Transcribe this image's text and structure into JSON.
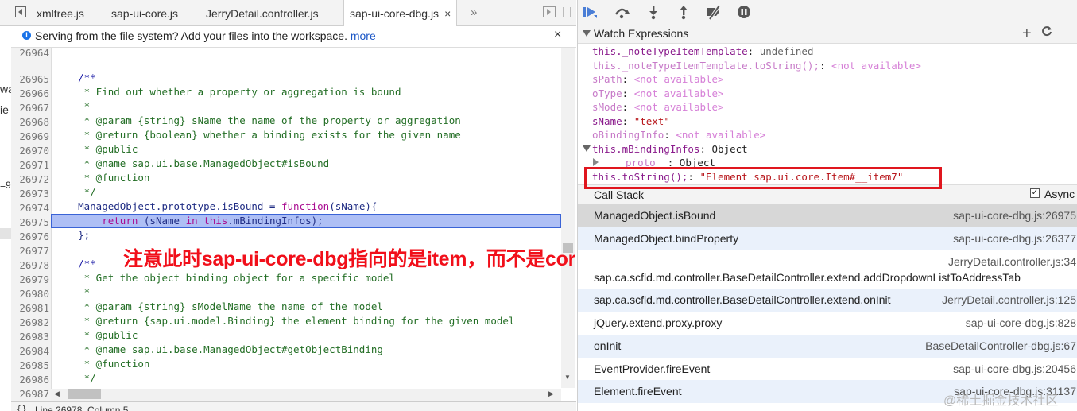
{
  "editor": {
    "tabs": [
      {
        "label": "xmltree.js"
      },
      {
        "label": "sap-ui-core.js"
      },
      {
        "label": "JerryDetail.controller.js"
      },
      {
        "label": "sap-ui-core-dbg.js",
        "active": true
      }
    ],
    "more_tabs": "»",
    "infobar": {
      "message": "Serving from the file system? Add your files into the workspace.",
      "link": "more",
      "close": "×"
    },
    "side_fragments": [
      "wa",
      "ie",
      "=9"
    ],
    "line_numbers": [
      "26964",
      "26965",
      "26966",
      "26967",
      "26968",
      "26969",
      "26970",
      "26971",
      "26972",
      "26973",
      "26974",
      "26975",
      "26976",
      "26977",
      "26978",
      "26979",
      "26980",
      "26981",
      "26982",
      "26983",
      "26984",
      "26985",
      "26986",
      "26987"
    ],
    "code": {
      "l26965": "    /**",
      "l26966": "     * Find out whether a property or aggregation is bound",
      "l26967": "     *",
      "l26968": "     * @param {string} sName the name of the property or aggregation",
      "l26969": "     * @return {boolean} whether a binding exists for the given name",
      "l26970": "     * @public",
      "l26971": "     * @name sap.ui.base.ManagedObject#isBound",
      "l26972": "     * @function",
      "l26973": "     */",
      "l26974_a": "    ManagedObject.prototype.isBound = ",
      "l26974_b": "function",
      "l26974_c": "(sName){",
      "l26975_a": "        ",
      "l26975_b": "return",
      "l26975_c": " (sName ",
      "l26975_d": "in",
      "l26975_e": " ",
      "l26975_f": "this",
      "l26975_g": ".mBindingInfos);",
      "l26976": "    };",
      "l26978": "    /**",
      "l26979": "     * Get the object binding object for a specific model",
      "l26980": "     *",
      "l26981": "     * @param {string} sModelName the name of the model",
      "l26982": "     * @return {sap.ui.model.Binding} the element binding for the given model",
      "l26983": "     * @public",
      "l26984": "     * @name sap.ui.base.ManagedObject#getObjectBinding",
      "l26985": "     * @function",
      "l26986": "     */"
    },
    "status": "Line 26978, Column 5",
    "annotation": "注意此时sap-ui-core-dbg指向的是item，而不是core"
  },
  "debugger": {
    "toolbar_icons": [
      "resume-icon",
      "step-over-icon",
      "step-into-icon",
      "step-out-icon",
      "deactivate-breakpoints-icon",
      "pause-on-exceptions-icon"
    ],
    "watch": {
      "title": "Watch Expressions",
      "add": "+",
      "refresh": "C",
      "items": [
        {
          "name": "this._noteTypeItemTemplate",
          "sep": ": ",
          "value": "undefined",
          "kind": "undef",
          "dim": false
        },
        {
          "name": "this._noteTypeItemTemplate.toString();",
          "sep": ": ",
          "value": "<not available>",
          "kind": "na",
          "dim": true
        },
        {
          "name": "sPath",
          "sep": ": ",
          "value": "<not available>",
          "kind": "na",
          "dim": true
        },
        {
          "name": "oType",
          "sep": ": ",
          "value": "<not available>",
          "kind": "na",
          "dim": true
        },
        {
          "name": "sMode",
          "sep": ": ",
          "value": "<not available>",
          "kind": "na",
          "dim": true
        },
        {
          "name": "sName",
          "sep": ": ",
          "value": "\"text\"",
          "kind": "str",
          "dim": false
        },
        {
          "name": "oBindingInfo",
          "sep": ": ",
          "value": "<not available>",
          "kind": "na",
          "dim": true
        },
        {
          "name": "this.mBindingInfos",
          "sep": ": ",
          "value": "Object",
          "kind": "obj",
          "dim": false
        },
        {
          "name": "__proto__",
          "sep": ": ",
          "value": "Object",
          "kind": "obj",
          "dim": true
        },
        {
          "name": "this.toString();",
          "sep": ": ",
          "value": "\"Element sap.ui.core.Item#__item7\"",
          "kind": "str",
          "dim": false
        }
      ]
    },
    "callstack": {
      "title": "Call Stack",
      "async_label": "Async",
      "async_checked": "✓",
      "frames": [
        {
          "fn": "ManagedObject.isBound",
          "loc": "sap-ui-core-dbg.js:26975"
        },
        {
          "fn": "ManagedObject.bindProperty",
          "loc": "sap-ui-core-dbg.js:26377"
        },
        {
          "fn": "sap.ca.scfld.md.controller.BaseDetailController.extend.addDropdownListToAddressTab",
          "loc": "JerryDetail.controller.js:34"
        },
        {
          "fn": "sap.ca.scfld.md.controller.BaseDetailController.extend.onInit",
          "loc": "JerryDetail.controller.js:125"
        },
        {
          "fn": "jQuery.extend.proxy.proxy",
          "loc": "sap-ui-core-dbg.js:828"
        },
        {
          "fn": "onInit",
          "loc": "BaseDetailController-dbg.js:67"
        },
        {
          "fn": "EventProvider.fireEvent",
          "loc": "sap-ui-core-dbg.js:20456"
        },
        {
          "fn": "Element.fireEvent",
          "loc": "sap-ui-core-dbg.js:31137"
        }
      ]
    },
    "watermark": "@稀土掘金技术社区"
  }
}
